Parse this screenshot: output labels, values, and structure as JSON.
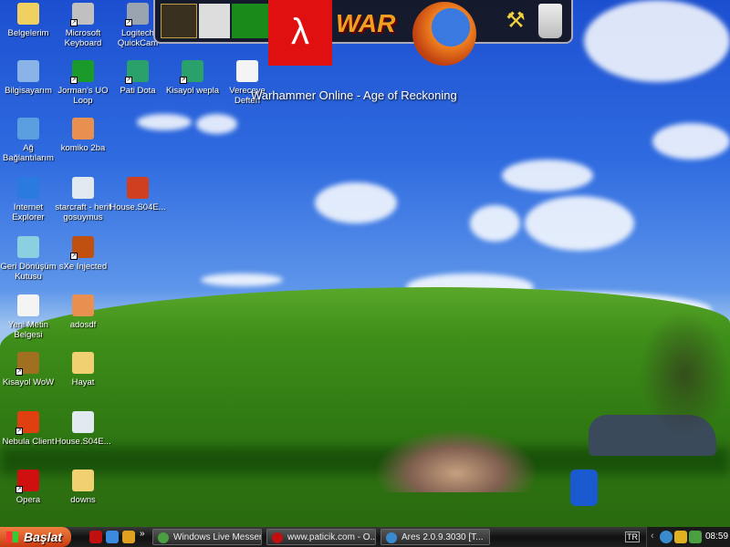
{
  "desktop_icons": [
    {
      "label": "Belgelerim",
      "color": "#f0d060"
    },
    {
      "label": "Microsoft Keyboard",
      "color": "#c0c0c0"
    },
    {
      "label": "Logitech QuickCam",
      "color": "#9aa4b0"
    },
    {
      "label": "Bilgisayarım",
      "color": "#8ab4e8"
    },
    {
      "label": "Jorman's UO Loop",
      "color": "#1a9a2a"
    },
    {
      "label": "Pati Dota",
      "color": "#2aa06a"
    },
    {
      "label": "Kisayol wepla",
      "color": "#2aa06a"
    },
    {
      "label": "Vereceye Defteri",
      "color": "#f4f4f4"
    },
    {
      "label": "Ağ Bağlantılarım",
      "color": "#5aa0e0"
    },
    {
      "label": "komiko 2ba",
      "color": "#e89050"
    },
    {
      "label": "Internet Explorer",
      "color": "#2a7ae0"
    },
    {
      "label": "starcraft - herif gosuymus",
      "color": "#e0e8f0"
    },
    {
      "label": "House.S04E...",
      "color": "#d04020"
    },
    {
      "label": "Geri Dönüşüm Kutusu",
      "color": "#8ad0e0"
    },
    {
      "label": "sXe Injected",
      "color": "#c05010"
    },
    {
      "label": "Yeni Metin Belgesi",
      "color": "#f4f4f4"
    },
    {
      "label": "adosdf",
      "color": "#e89050"
    },
    {
      "label": "Kisayol WoW",
      "color": "#a07020"
    },
    {
      "label": "Hayat",
      "color": "#f0d070"
    },
    {
      "label": "Nebula Client",
      "color": "#e04010"
    },
    {
      "label": "House.S04E...",
      "color": "#e0e8f0"
    },
    {
      "label": "Opera",
      "color": "#d01010"
    },
    {
      "label": "downs",
      "color": "#f0d070"
    }
  ],
  "dock": {
    "tooltip": "Warhammer Online - Age of Reckoning",
    "logo_text": "WAR",
    "items": [
      "warcraft",
      "counter-strike",
      "trackmania",
      "half-life",
      "warhammer",
      "firefox",
      "tool",
      "recycle-bin"
    ]
  },
  "taskbar": {
    "start_label": "Başlat",
    "tasks": [
      "Windows Live Messen...",
      "www.paticik.com - O...",
      "Ares 2.0.9.3030  [T..."
    ],
    "language": "TR",
    "clock": "08:59"
  }
}
